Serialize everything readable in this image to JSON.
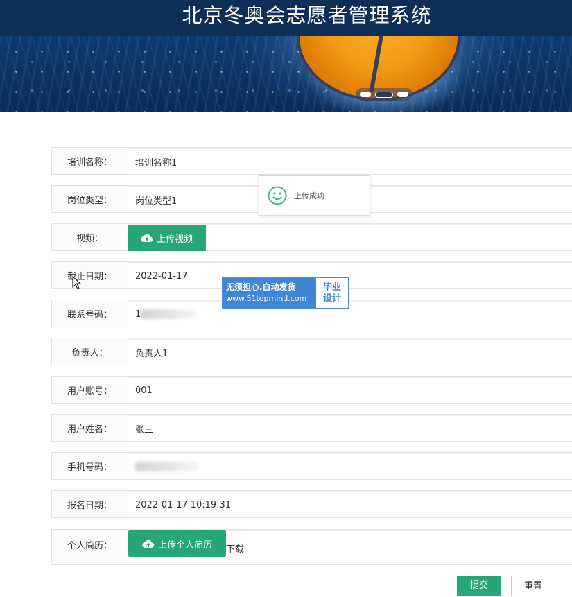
{
  "header": {
    "title": "北京冬奥会志愿者管理系统",
    "carousel_slides": 3,
    "carousel_active": 2
  },
  "form": {
    "rows": [
      {
        "label": "培训名称：",
        "value": "培训名称1"
      },
      {
        "label": "岗位类型：",
        "value": "岗位类型1"
      },
      {
        "label": "视频：",
        "button": "上传视频"
      },
      {
        "label": "截止日期：",
        "value": "2022-01-17"
      },
      {
        "label": "联系号码：",
        "value": "1",
        "masked": true
      },
      {
        "label": "负责人：",
        "value": "负责人1"
      },
      {
        "label": "用户账号：",
        "value": "001"
      },
      {
        "label": "用户姓名：",
        "value": "张三"
      },
      {
        "label": "手机号码：",
        "value": "",
        "masked": true
      },
      {
        "label": "报名日期：",
        "value": "2022-01-17 10:19:31"
      },
      {
        "label": "个人简历：",
        "button": "上传个人简历",
        "link": "下载"
      }
    ]
  },
  "toast": {
    "message": "上传成功",
    "icon": "smile-icon"
  },
  "watermark": {
    "line1": "无须担心.自动发货",
    "line2": "www.51topmind.com",
    "tag1": "毕业",
    "tag2": "设计"
  },
  "actions": {
    "submit": "提交",
    "reset": "重置"
  },
  "colors": {
    "primary": "#27a677",
    "header": "#0e2d57",
    "watermark": "#3f86d4"
  }
}
